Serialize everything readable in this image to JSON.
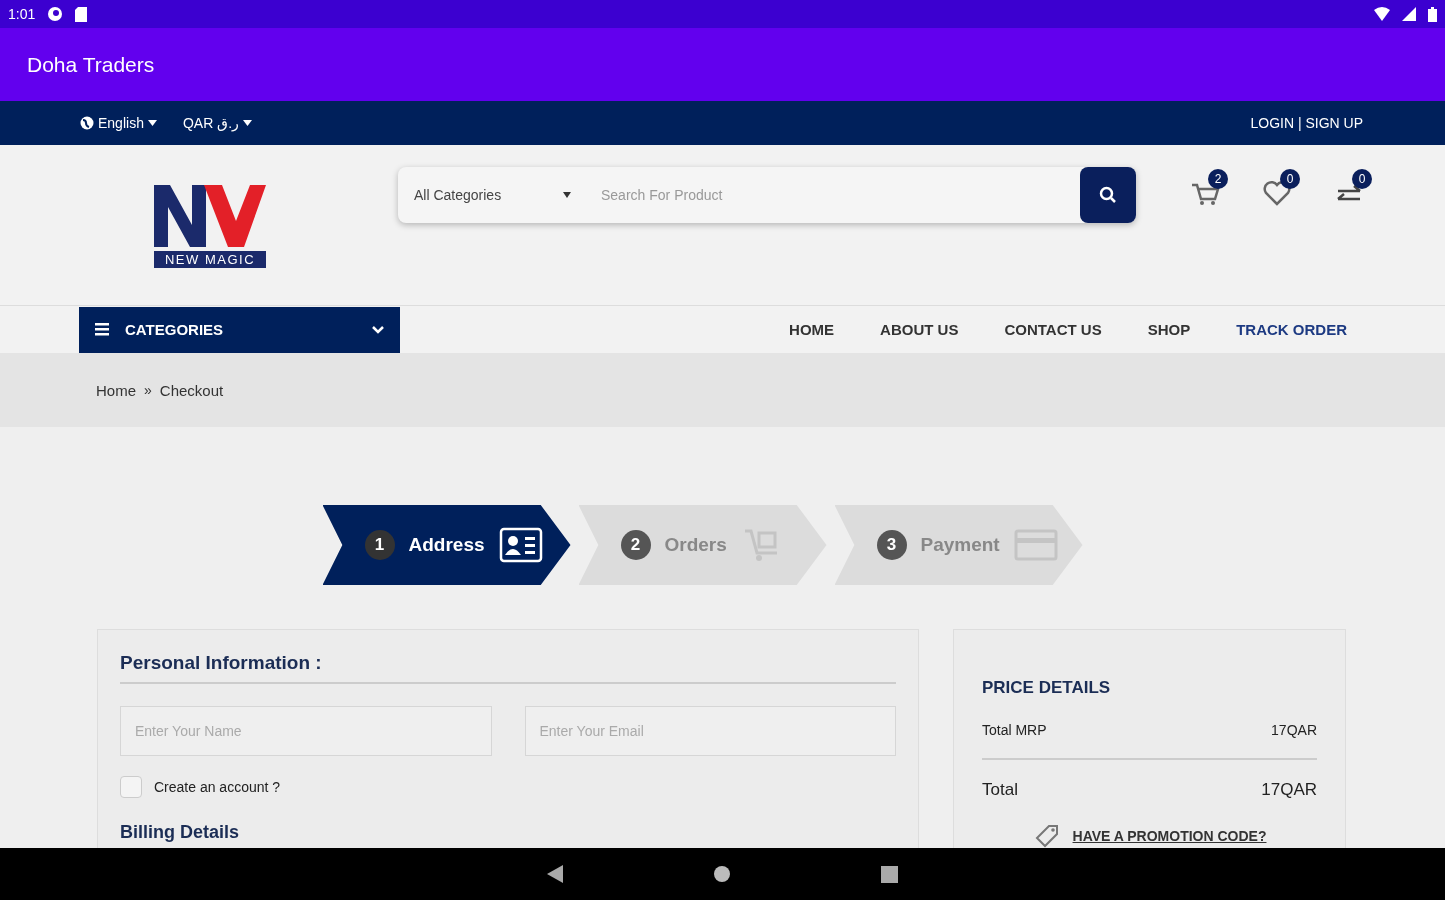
{
  "status_bar": {
    "time": "1:01"
  },
  "app_bar": {
    "title": "Doha Traders"
  },
  "top_bar": {
    "language": "English",
    "currency": "QAR ر.ق",
    "auth": "LOGIN | SIGN UP"
  },
  "header": {
    "logo_text": "NEW MAGIC",
    "search": {
      "category": "All Categories",
      "placeholder": "Search For Product"
    },
    "icons": [
      {
        "kind": "cart",
        "count": "2"
      },
      {
        "kind": "wishlist",
        "count": "0"
      },
      {
        "kind": "compare",
        "count": "0"
      }
    ]
  },
  "nav": {
    "categories": "CATEGORIES",
    "links": [
      {
        "label": "HOME",
        "selected": false
      },
      {
        "label": "ABOUT US",
        "selected": false
      },
      {
        "label": "CONTACT US",
        "selected": false
      },
      {
        "label": "SHOP",
        "selected": false
      },
      {
        "label": "TRACK ORDER",
        "selected": true
      }
    ]
  },
  "breadcrumb": [
    "Home",
    "Checkout"
  ],
  "breadcrumb_separator": "»",
  "steps": [
    {
      "number": "1",
      "label": "Address",
      "kind": "address",
      "selected": true
    },
    {
      "number": "2",
      "label": "Orders",
      "kind": "orders",
      "selected": false
    },
    {
      "number": "3",
      "label": "Payment",
      "kind": "payment",
      "selected": false
    }
  ],
  "personal": {
    "title": "Personal Information :",
    "name_placeholder": "Enter Your Name",
    "email_placeholder": "Enter Your Email",
    "create_account": {
      "label": "Create an account ?",
      "checked": false
    },
    "next_heading": "Billing Details"
  },
  "price": {
    "title": "PRICE DETAILS",
    "rows": [
      {
        "label": "Total MRP",
        "value": "17QAR",
        "kind": "sub"
      },
      {
        "label": "Total",
        "value": "17QAR",
        "kind": "total"
      }
    ],
    "promo": "HAVE A PROMOTION CODE?"
  }
}
